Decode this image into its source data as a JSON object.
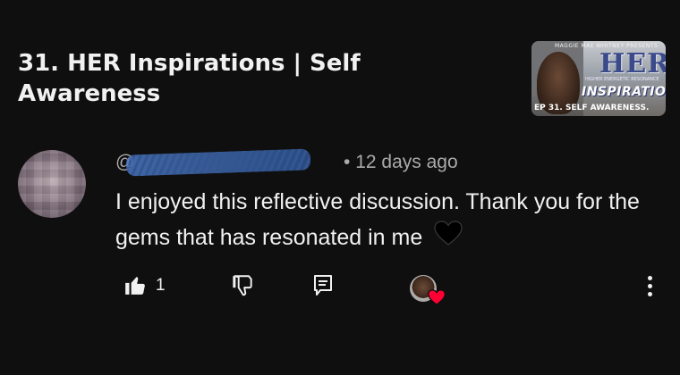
{
  "video": {
    "title": "31. HER Inspirations | Self Awareness",
    "thumbnail": {
      "top_text": "MAGGIE MAE WHITNEY PRESENTS",
      "logo_text": "HER",
      "tagline": "HIGHER ENERGETIC RESONANCE",
      "subtitle": "INSPIRATIONS",
      "episode": "EP 31. SELF AWARENESS."
    }
  },
  "comment": {
    "handle": "@",
    "separator": "•",
    "time_ago": "12 days ago",
    "text": "I enjoyed this reflective discussion. Thank you for the gems that has resonated in me",
    "emoji": "black-heart"
  },
  "actions": {
    "like_icon": "thumbs-up-filled-icon",
    "like_count": "1",
    "dislike_icon": "thumbs-down-icon",
    "reply_icon": "reply-comment-icon",
    "creator_heart_icon": "creator-heart-icon",
    "menu_icon": "more-vertical-icon"
  },
  "colors": {
    "background": "#0f0f0f",
    "text_primary": "#f1f1f1",
    "text_secondary": "#aaaaaa",
    "heart_red": "#ff0033"
  }
}
